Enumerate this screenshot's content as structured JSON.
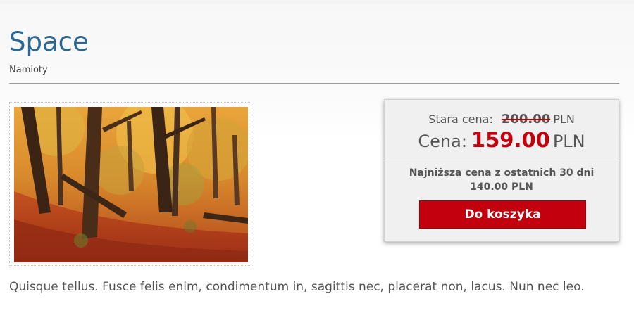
{
  "product": {
    "title": "Space",
    "category": "Namioty",
    "description": "Quisque tellus. Fusce felis enim, condimentum in, sagittis nec, placerat non, lacus. Nun nec leo."
  },
  "pricing": {
    "old_label": "Stara cena:",
    "old_value": "200.00",
    "old_currency": "PLN",
    "label": "Cena:",
    "value": "159.00",
    "currency": "PLN",
    "lowest_line1": "Najniższa cena z ostatnich 30 dni",
    "lowest_line2": "140.00 PLN",
    "cart_button_label": "Do koszyka"
  },
  "colors": {
    "title": "#2d6793",
    "price": "#c3000d",
    "button": "#c3000d"
  }
}
